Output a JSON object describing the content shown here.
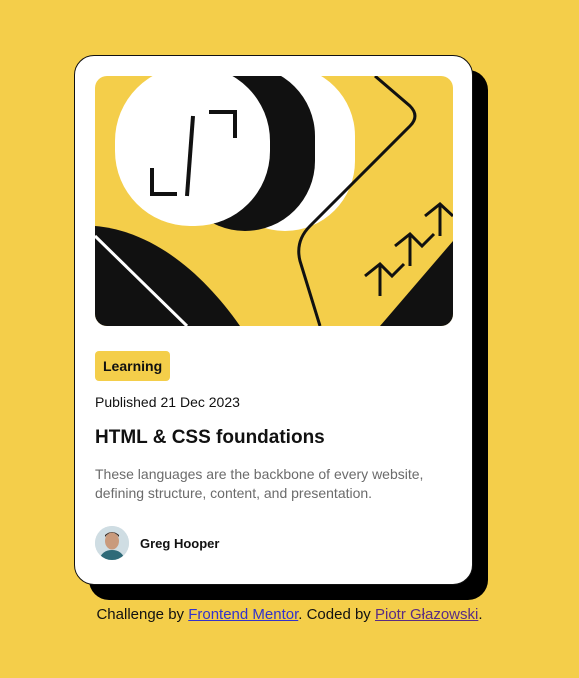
{
  "card": {
    "category": "Learning",
    "published_label": "Published",
    "published_date": "21 Dec 2023",
    "title": "HTML & CSS foundations",
    "description": "These languages are the backbone of every website, defining structure, content, and presentation.",
    "author": {
      "name": "Greg Hooper",
      "avatar": "author-avatar"
    },
    "hero_image": "illustration"
  },
  "attribution": {
    "prefix": "Challenge by ",
    "link1": "Frontend Mentor",
    "middle": ". Coded by ",
    "link2": "Piotr Głazowski",
    "suffix": "."
  },
  "colors": {
    "background": "#f4ce4a",
    "card": "#ffffff",
    "shadow": "#000000",
    "text": "#111111",
    "muted_text": "#6b6b6b",
    "link": "#3333cc",
    "visited_link": "#5a2c84"
  }
}
